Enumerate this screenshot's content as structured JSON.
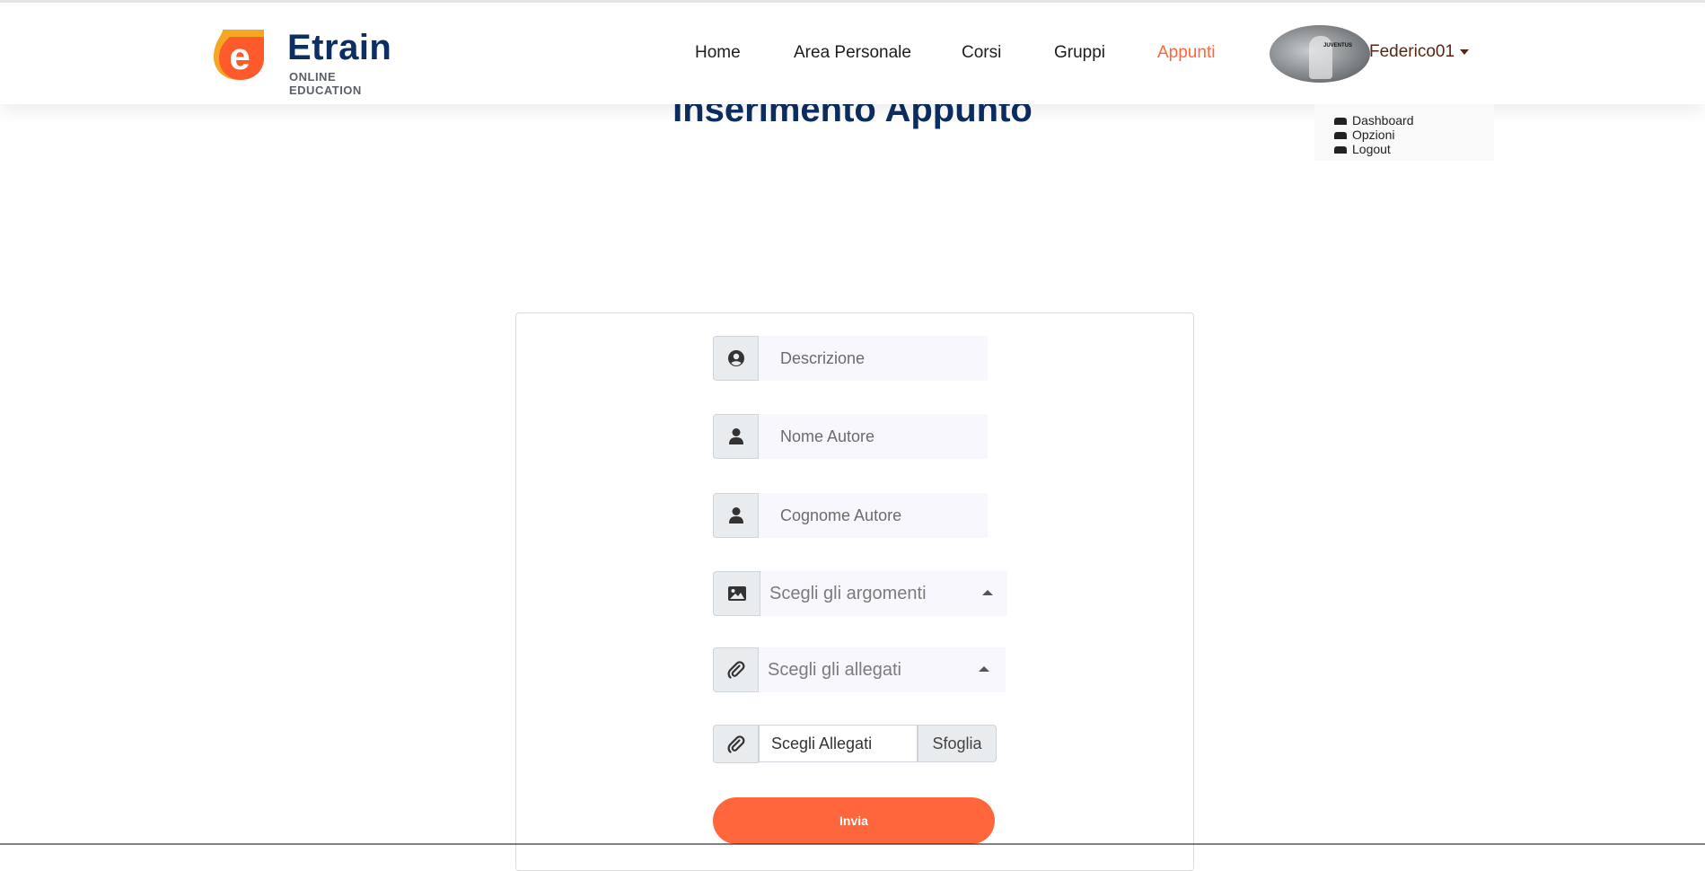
{
  "brand": {
    "name": "Etrain",
    "tagline": "ONLINE EDUCATION",
    "accent_color": "#ff663b",
    "title_color": "#0c2e60"
  },
  "nav": {
    "items": [
      {
        "label": "Home",
        "active": false
      },
      {
        "label": "Area Personale",
        "active": false
      },
      {
        "label": "Corsi",
        "active": false
      },
      {
        "label": "Gruppi",
        "active": false
      },
      {
        "label": "Appunti",
        "active": true
      }
    ]
  },
  "user": {
    "username": "Federico01",
    "avatar_text": "JUVENTUS",
    "menu": [
      {
        "label": "Dashboard",
        "icon": "user-icon"
      },
      {
        "label": "Opzioni",
        "icon": "options-icon"
      },
      {
        "label": "Logout",
        "icon": "logout-icon"
      }
    ]
  },
  "page": {
    "title": "Inserimento Appunto"
  },
  "form": {
    "descrizione": {
      "placeholder": "Descrizione",
      "icon": "user-circle-icon"
    },
    "nome_autore": {
      "placeholder": "Nome Autore",
      "icon": "user-icon"
    },
    "cognome_autore": {
      "placeholder": "Cognome Autore",
      "icon": "user-icon"
    },
    "argomenti": {
      "placeholder": "Scegli gli argomenti",
      "icon": "image-icon"
    },
    "allegati_select": {
      "placeholder": "Scegli gli allegati",
      "icon": "paperclip-icon"
    },
    "file_input": {
      "label": "Scegli Allegati",
      "browse": "Sfoglia",
      "icon": "paperclip-icon"
    },
    "submit": "Invia"
  }
}
